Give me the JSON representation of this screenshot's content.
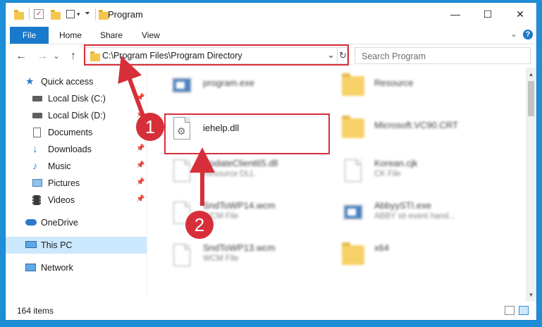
{
  "window": {
    "title": "Program",
    "controls": {
      "minimize": "—",
      "maximize": "☐",
      "close": "✕"
    }
  },
  "ribbon": {
    "tabs": [
      "File",
      "Home",
      "Share",
      "View"
    ],
    "expand_icon": "chevron-down-icon",
    "help_icon": "?"
  },
  "address": {
    "path": "C:\\Program Files\\Program Directory",
    "search_placeholder": "Search Program",
    "dropdown_glyph": "⌄",
    "refresh_glyph": "↻"
  },
  "nav_buttons": {
    "back": "←",
    "forward": "→",
    "recent": "⌄",
    "up": "↑"
  },
  "sidebar": {
    "items": [
      {
        "label": "Quick access",
        "icon": "star-icon",
        "pinned": false
      },
      {
        "label": "Local Disk (C:)",
        "icon": "drive-icon",
        "pinned": true
      },
      {
        "label": "Local Disk (D:)",
        "icon": "drive-icon",
        "pinned": true
      },
      {
        "label": "Documents",
        "icon": "documents-icon",
        "pinned": true
      },
      {
        "label": "Downloads",
        "icon": "download-icon",
        "pinned": true
      },
      {
        "label": "Music",
        "icon": "music-icon",
        "pinned": true
      },
      {
        "label": "Pictures",
        "icon": "pictures-icon",
        "pinned": true
      },
      {
        "label": "Videos",
        "icon": "videos-icon",
        "pinned": true
      },
      {
        "label": "OneDrive",
        "icon": "cloud-icon",
        "pinned": false
      },
      {
        "label": "This PC",
        "icon": "computer-icon",
        "pinned": false,
        "selected": true
      },
      {
        "label": "Network",
        "icon": "network-icon",
        "pinned": false
      }
    ],
    "pin_glyph": "📌"
  },
  "files": [
    {
      "name": "program.exe",
      "subtitle": "",
      "kind": "exe",
      "blurred": true
    },
    {
      "name": "Resource",
      "subtitle": "",
      "kind": "folder",
      "blurred": true
    },
    {
      "name": "iehelp.dll",
      "subtitle": "",
      "kind": "dll",
      "blurred": false
    },
    {
      "name": "Microsoft.VC90.CRT",
      "subtitle": "",
      "kind": "folder",
      "blurred": true
    },
    {
      "name": "UpdateClient65.dll",
      "subtitle": "Resource DLL",
      "kind": "doc",
      "blurred": true
    },
    {
      "name": "Korean.cjk",
      "subtitle": "CK File",
      "kind": "doc",
      "blurred": true
    },
    {
      "name": "SndToWP14.wcm",
      "subtitle": "WCM File",
      "kind": "doc",
      "blurred": true
    },
    {
      "name": "AbbyySTI.exe",
      "subtitle": "ABBY sti event hand...",
      "kind": "exe",
      "blurred": true
    },
    {
      "name": "SndToWP13.wcm",
      "subtitle": "WCM File",
      "kind": "doc",
      "blurred": true
    },
    {
      "name": "x64",
      "subtitle": "",
      "kind": "folder",
      "blurred": true
    }
  ],
  "status": {
    "item_count": "164 items"
  },
  "callouts": [
    "1",
    "2"
  ],
  "colors": {
    "accent": "#1979ca",
    "callout": "#d62f3a",
    "selection": "#cce8ff"
  }
}
